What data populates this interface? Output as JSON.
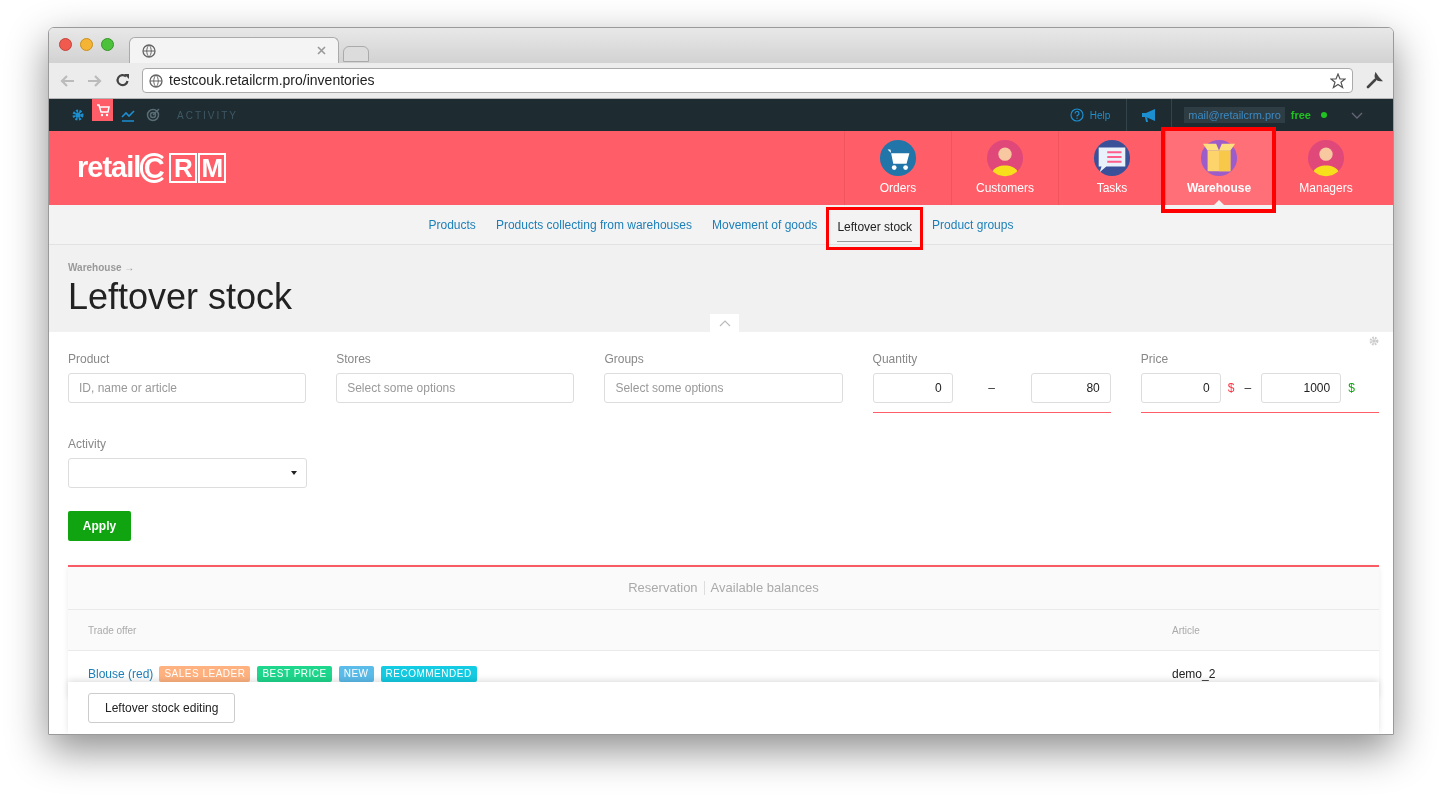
{
  "browser": {
    "url": "testcouk.retailcrm.pro/inventories"
  },
  "topbar": {
    "icons": [
      {
        "kind": "gear",
        "selected": false
      },
      {
        "kind": "cart",
        "selected": true
      },
      {
        "kind": "chart",
        "selected": false
      },
      {
        "kind": "target",
        "selected": false
      }
    ],
    "activity_label": "ACTIVITY",
    "help": "Help",
    "email": "mail@retailcrm.pro",
    "plan": "free"
  },
  "logo": {
    "text": "retail",
    "mark": [
      "C",
      "R",
      "M"
    ]
  },
  "nav": [
    {
      "label": "Orders",
      "kind": "cart",
      "selected": false,
      "highlighted": false
    },
    {
      "label": "Customers",
      "kind": "person",
      "selected": false,
      "highlighted": false
    },
    {
      "label": "Tasks",
      "kind": "list",
      "selected": false,
      "highlighted": false
    },
    {
      "label": "Warehouse",
      "kind": "box",
      "selected": true,
      "highlighted": true
    },
    {
      "label": "Managers",
      "kind": "person",
      "selected": false,
      "highlighted": false
    }
  ],
  "subnav": [
    {
      "label": "Products",
      "selected": false,
      "highlighted": false
    },
    {
      "label": "Products collecting from warehouses",
      "selected": false,
      "highlighted": false
    },
    {
      "label": "Movement of goods",
      "selected": false,
      "highlighted": false
    },
    {
      "label": "Leftover stock",
      "selected": true,
      "highlighted": true
    },
    {
      "label": "Product groups",
      "selected": false,
      "highlighted": false
    }
  ],
  "breadcrumb": "Warehouse →",
  "title": "Leftover stock",
  "filters": {
    "product": {
      "label": "Product",
      "placeholder": "ID, name or article"
    },
    "stores": {
      "label": "Stores",
      "placeholder": "Select some options"
    },
    "groups": {
      "label": "Groups",
      "placeholder": "Select some options"
    },
    "quantity": {
      "label": "Quantity",
      "from": "0",
      "separator": "–",
      "to": "80"
    },
    "price": {
      "label": "Price",
      "from": "0",
      "currency": "$",
      "separator": "–",
      "to": "1000"
    },
    "activity": {
      "label": "Activity"
    },
    "apply": "Apply"
  },
  "table": {
    "views": [
      {
        "label": "Reservation"
      },
      {
        "label": "Available balances"
      }
    ],
    "columns": [
      "Trade offer",
      "Article"
    ],
    "rows": [
      {
        "name": "Blouse (red)",
        "tags": [
          {
            "label": "SALES LEADER",
            "color": "#ffb27f"
          },
          {
            "label": "BEST PRICE",
            "color": "#1ed68c"
          },
          {
            "label": "NEW",
            "color": "#5bbbe9"
          },
          {
            "label": "RECOMMENDED",
            "color": "#13cbe2"
          }
        ],
        "article": "demo_2"
      }
    ]
  },
  "footer_button": "Leftover stock editing"
}
